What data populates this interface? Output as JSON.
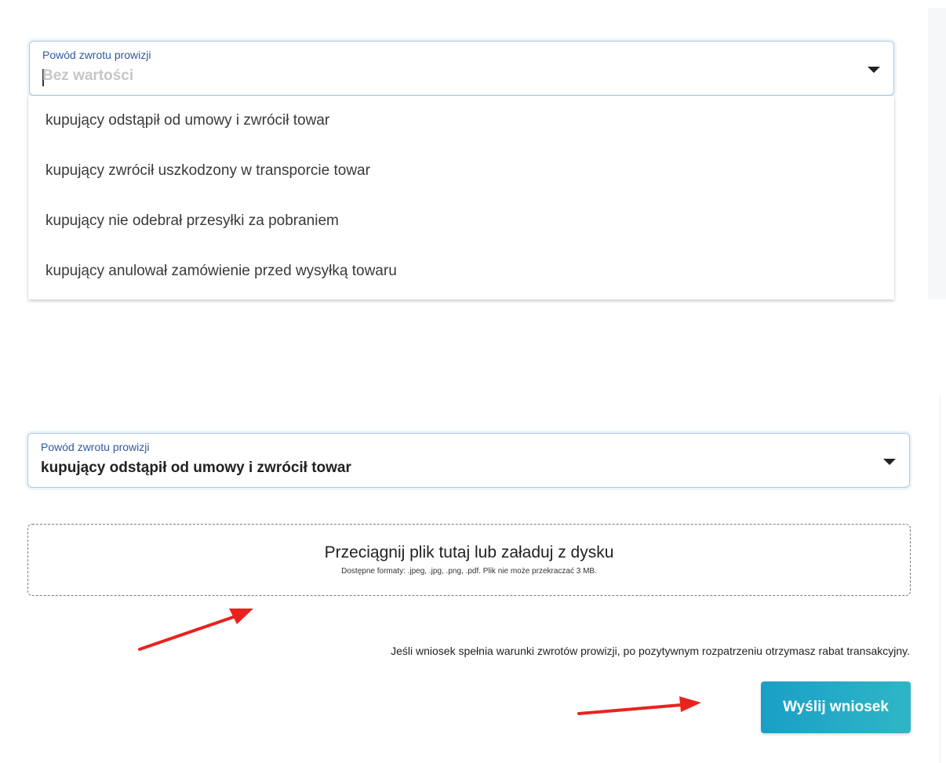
{
  "select_open": {
    "label": "Powód zwrotu prowizji",
    "placeholder": "Bez wartości",
    "options": [
      "kupujący odstąpił od umowy i zwrócił towar",
      "kupujący zwrócił uszkodzony w transporcie towar",
      "kupujący nie odebrał przesyłki za pobraniem",
      "kupujący anulował zamówienie przed wysyłką towaru"
    ]
  },
  "select_filled": {
    "label": "Powód zwrotu prowizji",
    "value": "kupujący odstąpił od umowy i zwrócił towar"
  },
  "upload": {
    "title": "Przeciągnij plik tutaj lub załaduj z dysku",
    "hint": "Dostępne formaty: .jpeg, .jpg, .png, .pdf. Plik nie może przekraczać 3 MB."
  },
  "info_text": "Jeśli wniosek spełnia warunki zwrotów prowizji, po pozytywnym rozpatrzeniu otrzymasz rabat transakcyjny.",
  "submit_label": "Wyślij wniosek",
  "colors": {
    "accent": "#1a9fc6",
    "label_blue": "#2c5aa0",
    "annotation_red": "#e8231f"
  }
}
